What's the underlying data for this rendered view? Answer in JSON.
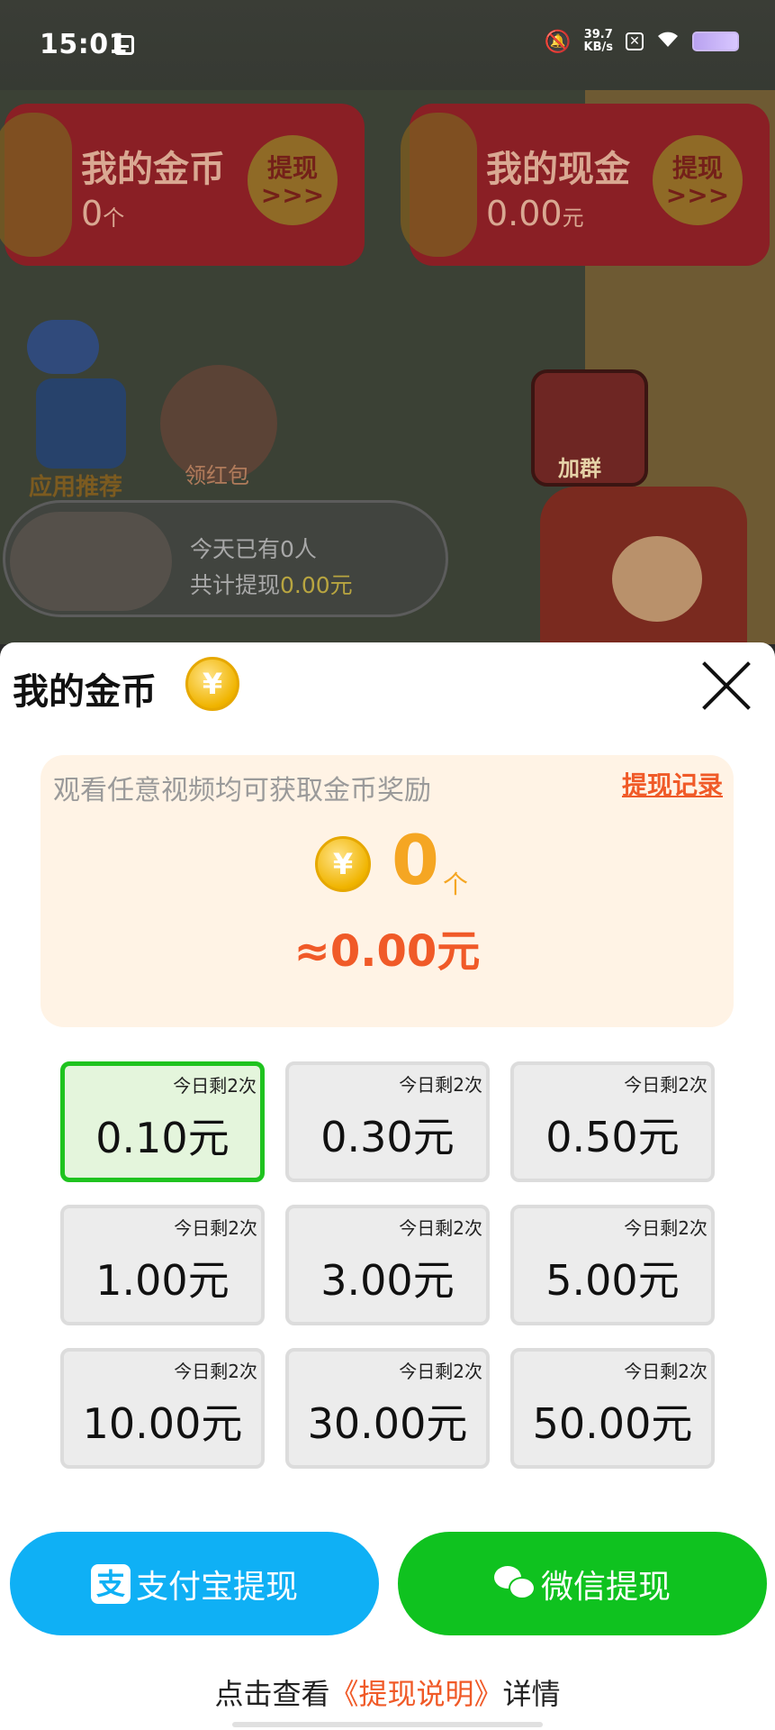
{
  "status_bar": {
    "time": "15:01",
    "speed_value": "39.7",
    "speed_unit": "KB/s"
  },
  "background": {
    "my_coins": {
      "title": "我的金币",
      "value": "0",
      "unit": "个",
      "button": "提现"
    },
    "my_cash": {
      "title": "我的现金",
      "value": "0.00",
      "unit": "元",
      "button": "提现"
    },
    "app_recommend_label": "应用推荐",
    "red_packet_label": "领红包",
    "join_group_label": "加群",
    "ticker": {
      "line1": "今天已有0人",
      "line2_prefix": "共计提现",
      "line2_amount": "0.00元"
    }
  },
  "sheet": {
    "title": "我的金币",
    "coin_symbol": "¥",
    "tip": "观看任意视频均可获取金币奖励",
    "history_link": "提现记录",
    "coin_count": "0",
    "coin_unit": "个",
    "cash_equivalent": "≈0.00元",
    "options": [
      {
        "amount": "0.10元",
        "remaining": "今日剩2次",
        "selected": true
      },
      {
        "amount": "0.30元",
        "remaining": "今日剩2次",
        "selected": false
      },
      {
        "amount": "0.50元",
        "remaining": "今日剩2次",
        "selected": false
      },
      {
        "amount": "1.00元",
        "remaining": "今日剩2次",
        "selected": false
      },
      {
        "amount": "3.00元",
        "remaining": "今日剩2次",
        "selected": false
      },
      {
        "amount": "5.00元",
        "remaining": "今日剩2次",
        "selected": false
      },
      {
        "amount": "10.00元",
        "remaining": "今日剩2次",
        "selected": false
      },
      {
        "amount": "30.00元",
        "remaining": "今日剩2次",
        "selected": false
      },
      {
        "amount": "50.00元",
        "remaining": "今日剩2次",
        "selected": false
      }
    ],
    "alipay_button": "支付宝提现",
    "alipay_icon_char": "支",
    "wechat_button": "微信提现",
    "footer_prefix": "点击查看",
    "footer_link": "《提现说明》",
    "footer_suffix": "详情"
  },
  "colors": {
    "accent_orange": "#f05a28",
    "coin_gold": "#f5a623",
    "alipay_blue": "#0fb0f5",
    "wechat_green": "#0fc21f",
    "selected_border": "#1fc31f"
  },
  "icons": [
    "calendar-icon",
    "bell-muted-icon",
    "wifi-icon",
    "battery-icon",
    "coin-icon",
    "close-icon",
    "alipay-icon",
    "wechat-icon"
  ]
}
